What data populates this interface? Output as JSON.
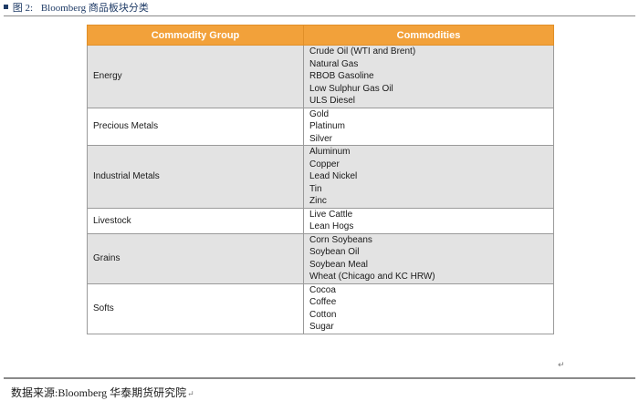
{
  "caption": {
    "prefix": "图 2:",
    "title": "Bloomberg 商品板块分类"
  },
  "table": {
    "headers": [
      "Commodity Group",
      "Commodities"
    ],
    "rows": [
      {
        "group": "Energy",
        "items": [
          "Crude Oil (WTI and Brent)",
          "Natural Gas",
          "RBOB Gasoline",
          "Low Sulphur Gas Oil",
          "ULS Diesel"
        ]
      },
      {
        "group": "Precious Metals",
        "items": [
          "Gold",
          "Platinum",
          "Silver"
        ]
      },
      {
        "group": "Industrial Metals",
        "items": [
          "Aluminum",
          "Copper",
          "Lead Nickel",
          "Tin",
          "Zinc"
        ]
      },
      {
        "group": "Livestock",
        "items": [
          "Live Cattle",
          "Lean Hogs"
        ]
      },
      {
        "group": "Grains",
        "items": [
          "Corn Soybeans",
          "Soybean Oil",
          "Soybean Meal",
          "Wheat (Chicago and KC HRW)"
        ]
      },
      {
        "group": "Softs",
        "items": [
          "Cocoa",
          "Coffee",
          "Cotton",
          "Sugar"
        ]
      }
    ]
  },
  "source": "数据来源:Bloomberg 华泰期货研究院",
  "marks": {
    "paragraph": "↵"
  },
  "colors": {
    "header_bg": "#f2a13a",
    "shaded_row": "#e3e3e3",
    "caption_text": "#1f3b66"
  }
}
